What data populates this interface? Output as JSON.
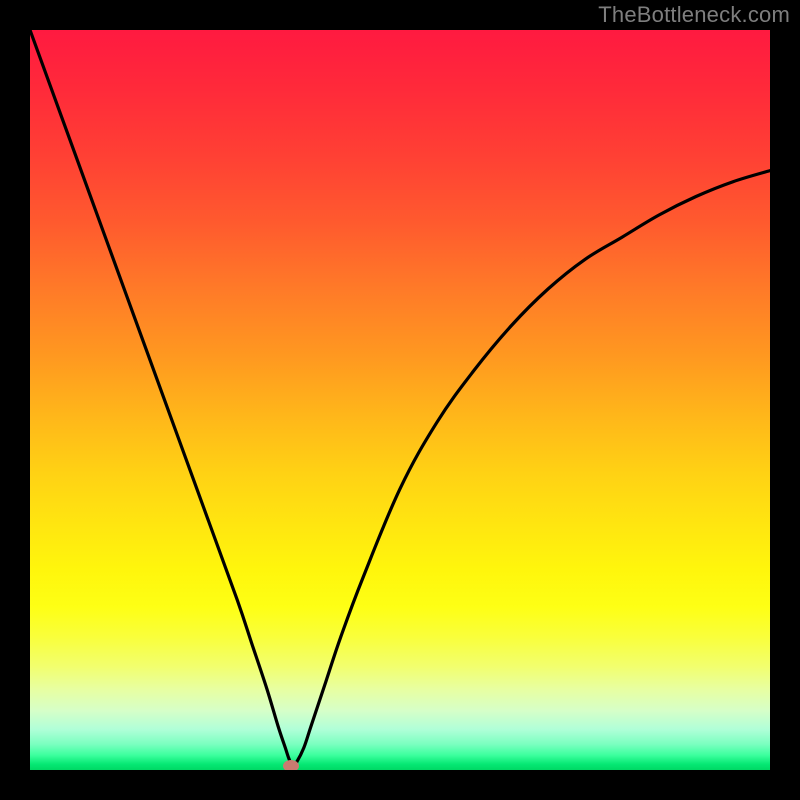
{
  "watermark": {
    "text": "TheBottleneck.com"
  },
  "chart_data": {
    "type": "line",
    "title": "",
    "xlabel": "",
    "ylabel": "",
    "xlim": [
      0,
      100
    ],
    "ylim": [
      0,
      100
    ],
    "grid": false,
    "legend": false,
    "series": [
      {
        "name": "bottleneck-curve",
        "x": [
          0,
          4,
          8,
          12,
          16,
          20,
          24,
          28,
          30,
          32,
          33.5,
          34.5,
          35,
          35.5,
          36,
          37,
          38,
          40,
          42,
          45,
          50,
          55,
          60,
          65,
          70,
          75,
          80,
          85,
          90,
          95,
          100
        ],
        "y": [
          100,
          89,
          78,
          67,
          56,
          45,
          34,
          23,
          17,
          11,
          6,
          3,
          1.5,
          0.5,
          1,
          3,
          6,
          12,
          18,
          26,
          38,
          47,
          54,
          60,
          65,
          69,
          72,
          75,
          77.5,
          79.5,
          81
        ]
      }
    ],
    "marker": {
      "x": 35.3,
      "y": 0.5,
      "color": "#c97b70"
    },
    "background_gradient": {
      "stops": [
        {
          "pos": 0.0,
          "color": "#ff1a40"
        },
        {
          "pos": 0.5,
          "color": "#ffc018"
        },
        {
          "pos": 0.78,
          "color": "#feff15"
        },
        {
          "pos": 1.0,
          "color": "#00d864"
        }
      ]
    },
    "frame_color": "#000000"
  }
}
